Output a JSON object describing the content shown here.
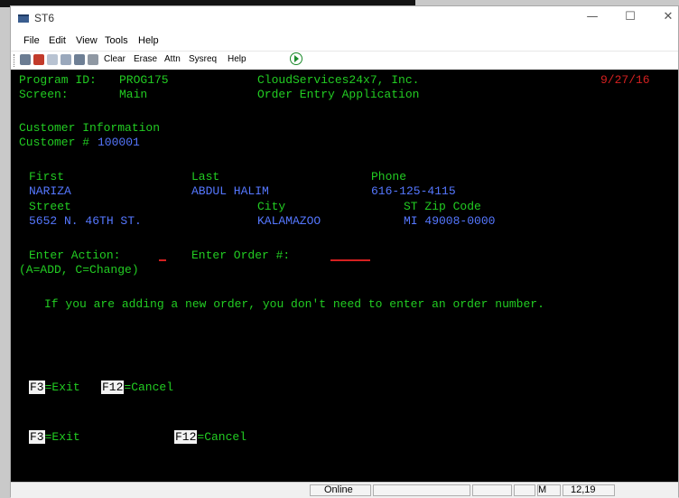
{
  "window": {
    "title": "ST6",
    "controls": [
      "—",
      "☐",
      "✕"
    ]
  },
  "menu": [
    "File",
    "Edit",
    "View",
    "Tools",
    "Help"
  ],
  "toolbar": {
    "clear": "Clear",
    "erase": "Erase",
    "attn": "Attn",
    "sysreq": "Sysreq",
    "help": "Help"
  },
  "screen": {
    "program_label": "Program ID:",
    "program_id": "PROG175",
    "company": "CloudServices24x7, Inc.",
    "date": "9/27/16",
    "screen_label": "Screen:",
    "screen_name": "Main",
    "app_name": "Order Entry Application",
    "section_title": "Customer Information",
    "customer_label": "Customer #",
    "customer_number": "100001",
    "first_label": "First",
    "first_value": "NARIZA",
    "last_label": "Last",
    "last_value": "ABDUL HALIM",
    "phone_label": "Phone",
    "phone_value": "616-125-4115",
    "street_label": "Street",
    "street_value": "5652 N. 46TH ST.",
    "city_label": "City",
    "city_value": "KALAMAZOO",
    "stzip_label": "ST Zip Code",
    "stzip_value": "MI 49008-0000",
    "action_label": "Enter Action:",
    "order_label": "Enter Order #:",
    "action_hint": "(A=ADD, C=Change)",
    "info_message": "If you are adding a new order, you don't need to enter an order number.",
    "fkeys_a": {
      "f3_key": "F3",
      "f3_text": "=Exit",
      "f12_key": "F12",
      "f12_text": "=Cancel"
    },
    "fkeys_b": {
      "f3_key": "F3",
      "f3_text": "=Exit",
      "f12_key": "F12",
      "f12_text": "=Cancel"
    }
  },
  "status": {
    "connection": "Online",
    "mode": "M",
    "cursor": "12,19"
  },
  "colors": {
    "screen_bg": "#000000",
    "label_green": "#22cc22",
    "value_blue": "#5577ff",
    "date_red": "#d42020"
  }
}
